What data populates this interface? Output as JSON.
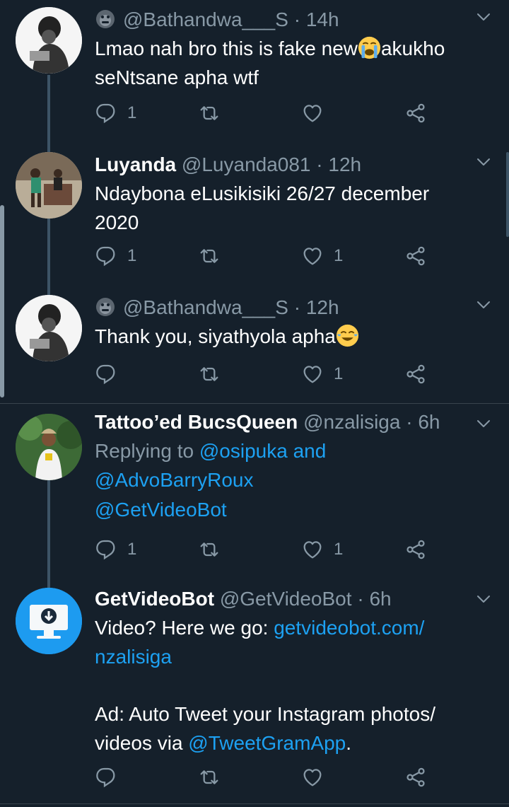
{
  "tweets": [
    {
      "handle": "@Bathandwa___S",
      "sep": "·",
      "time": "14h",
      "text_before": "Lmao nah bro this is fake new",
      "text_after": "akukho seNtsane apha wtf",
      "emoji_icon": "loudly-crying-face-icon",
      "reply_count": "1",
      "retweet_count": "",
      "like_count": ""
    },
    {
      "name": "Luyanda",
      "handle": "@Luyanda081",
      "sep": "·",
      "time": "12h",
      "text": "Ndaybona eLusikisiki 26/27 december 2020",
      "reply_count": "1",
      "retweet_count": "",
      "like_count": "1"
    },
    {
      "handle": "@Bathandwa___S",
      "sep": "·",
      "time": "12h",
      "text_before": "Thank you, siyathyola apha",
      "emoji_icon": "face-with-tears-of-joy-icon",
      "reply_count": "",
      "retweet_count": "",
      "like_count": "1"
    },
    {
      "name": "Tattoo’ed BucsQueen",
      "handle": "@nzalisiga",
      "sep": "·",
      "time": "6h",
      "replying_to": "Replying to",
      "reply_user1": "@osipuka",
      "and": "and",
      "reply_user2": "@AdvoBarryRoux",
      "mention": "@GetVideoBot",
      "reply_count": "1",
      "retweet_count": "",
      "like_count": "1"
    },
    {
      "name": "GetVideoBot",
      "handle": "@GetVideoBot",
      "sep": "·",
      "time": "6h",
      "text_prefix": "Video? Here we go:",
      "link": "getvideobot.com/ nzalisiga",
      "ad_text": "Ad: Auto Tweet your Instagram photos/ videos via",
      "ad_link": "@TweetGramApp",
      "ad_end": ".",
      "reply_count": "",
      "retweet_count": "",
      "like_count": ""
    }
  ],
  "colors": {
    "background": "#15202b",
    "secondary_text": "#8899a6",
    "link": "#1da1f2",
    "divider": "#38444d"
  }
}
